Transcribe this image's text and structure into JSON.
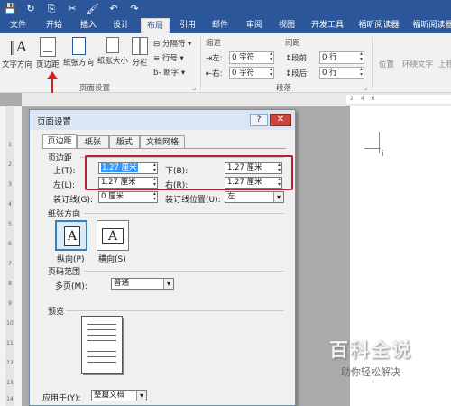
{
  "quick_access": [
    "💾",
    "↻",
    "⎘",
    "✂",
    "🖌",
    "↶",
    "↷"
  ],
  "ribbon_tabs": [
    "文件",
    "开始",
    "插入",
    "设计",
    "布局",
    "引用",
    "邮件",
    "审阅",
    "视图",
    "开发工具",
    "福昕阅读器",
    "福昕阅读器"
  ],
  "active_tab": "布局",
  "ribbon": {
    "text_direction": "文字方向",
    "margins": "页边距",
    "orientation": "纸张方向",
    "size": "纸张大小",
    "columns": "分栏",
    "breaks": "分隔符",
    "line_numbers": "行号",
    "hyphenation": "断字",
    "page_setup_group": "页面设置",
    "indent_header": "缩进",
    "indent_left_label": "左:",
    "indent_left_value": "0 字符",
    "indent_right_label": "右:",
    "indent_right_value": "0 字符",
    "spacing_header": "间距",
    "spacing_before_label": "段前:",
    "spacing_before_value": "0 行",
    "spacing_after_label": "段后:",
    "spacing_after_value": "0 行",
    "paragraph_group": "段落",
    "position": "位置",
    "wrap_text": "环绕文字",
    "bring_forward": "上移"
  },
  "ruler_top_marks": "2 4 6",
  "ruler_left_numbers": [
    "1",
    "2",
    "3",
    "4",
    "5",
    "6",
    "7",
    "8",
    "9",
    "10",
    "11",
    "12",
    "13",
    "14"
  ],
  "dialog": {
    "title": "页面设置",
    "help": "?",
    "close": "✕",
    "tabs": [
      "页边距",
      "纸张",
      "版式",
      "文档网格"
    ],
    "margins_section": "页边距",
    "top_label": "上(T):",
    "top_value": "1.27 厘米",
    "bottom_label": "下(B):",
    "bottom_value": "1.27 厘米",
    "left_label": "左(L):",
    "left_value": "1.27 厘米",
    "right_label": "右(R):",
    "right_value": "1.27 厘米",
    "gutter_label": "装订线(G):",
    "gutter_value": "0 厘米",
    "gutter_pos_label": "装订线位置(U):",
    "gutter_pos_value": "左",
    "orientation_section": "纸张方向",
    "portrait_glyph": "A",
    "portrait_label": "纵向(P)",
    "landscape_glyph": "A",
    "landscape_label": "横向(S)",
    "pages_section": "页码范围",
    "multiple_pages_label": "多页(M):",
    "multiple_pages_value": "普通",
    "preview_section": "预览",
    "apply_label": "应用于(Y):",
    "apply_value": "整篇文档"
  },
  "watermark": {
    "big": "百科全说",
    "small": "助你轻松解决"
  },
  "colors": {
    "title_bar": "#2b579a",
    "annotation_red": "#d42020"
  }
}
